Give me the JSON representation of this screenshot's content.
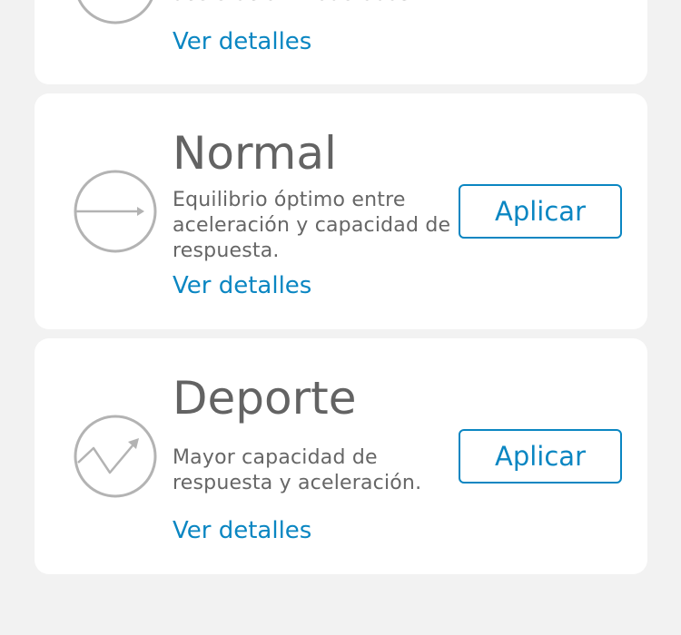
{
  "modes": [
    {
      "id": "previous",
      "description_partial": "aceleración moderadas.",
      "details_label": "Ver detalles"
    },
    {
      "id": "normal",
      "title": "Normal",
      "description": "Equilibrio óptimo entre aceleración y capacidad de respuesta.",
      "details_label": "Ver detalles",
      "apply_label": "Aplicar",
      "icon": "arrow-right-circle-icon"
    },
    {
      "id": "sport",
      "title": "Deporte",
      "description": "Mayor capacidad de respuesta y aceleración.",
      "details_label": "Ver detalles",
      "apply_label": "Aplicar",
      "icon": "zigzag-arrow-circle-icon"
    }
  ],
  "colors": {
    "background": "#f2f2f2",
    "card": "#ffffff",
    "accent": "#0a86c2",
    "title": "#636363",
    "text": "#666666",
    "icon": "#b3b3b3"
  }
}
